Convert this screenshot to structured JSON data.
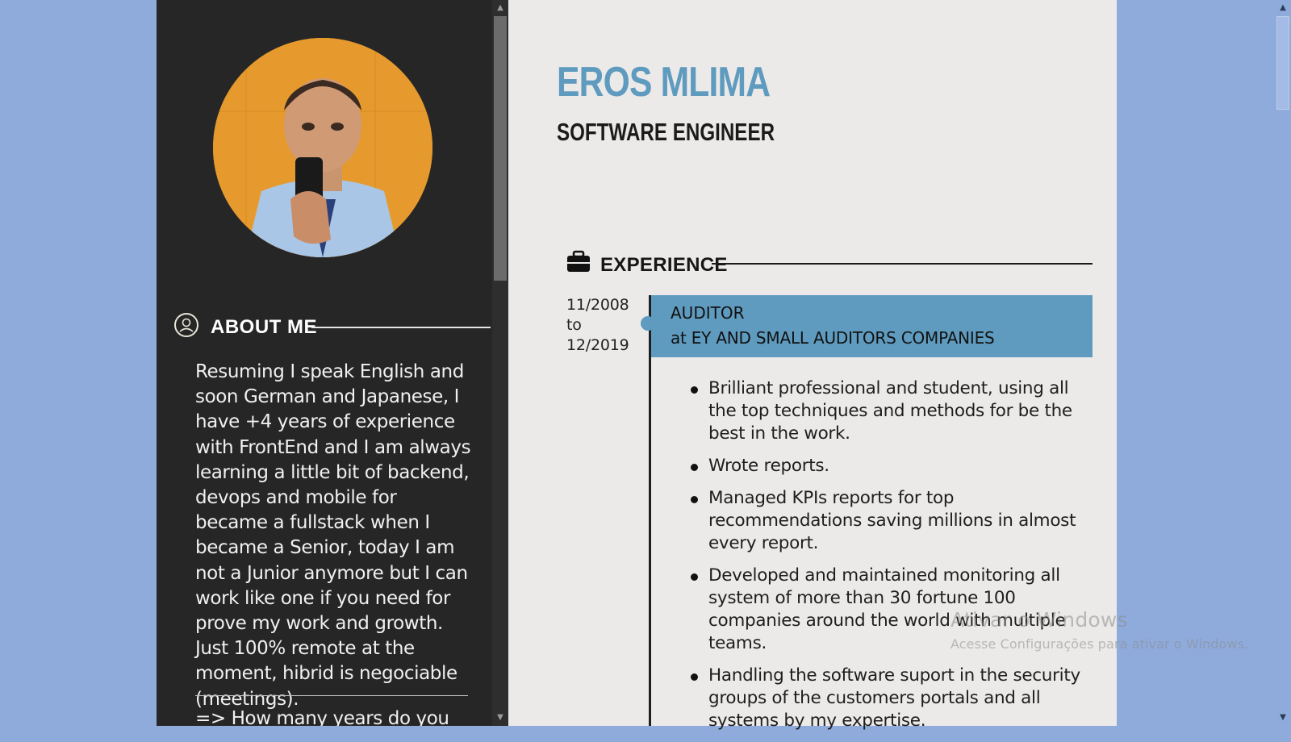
{
  "profile": {
    "name": "EROS MLIMA",
    "role": "SOFTWARE ENGINEER"
  },
  "sidebar": {
    "avatar_alt": "profile-photo",
    "about": {
      "title": "ABOUT ME",
      "text": "Resuming I speak English and soon German and Japanese, I have +4 years of experience with FrontEnd and I am always learning a little bit of backend, devops and mobile for became a fullstack when I became a Senior, today I am not a Junior anymore but I can work like one if you need for prove my work and growth. Just 100% remote at the moment, hibrid is negociable (meetings).",
      "question": "=> How many years do you"
    }
  },
  "experience": {
    "title": "EXPERIENCE",
    "jobs": [
      {
        "date_from": "11/2008",
        "date_sep": "to",
        "date_to": "12/2019",
        "position": "AUDITOR",
        "at_label": "at",
        "company": "EY AND SMALL AUDITORS COMPANIES",
        "bullets": [
          "Brilliant professional and student, using all the top techniques and methods for be the best in the work.",
          "Wrote reports.",
          "Managed KPIs reports for top recommendations saving millions in almost every report.",
          "Developed and maintained monitoring all system of more than 30 fortune 100 companies around the world with multiple teams.",
          "Handling the software suport in the security groups of the customers portals and all systems by my expertise."
        ]
      }
    ]
  },
  "watermark": {
    "line1": "Ativar o Windows",
    "line2": "Acesse Configurações para ativar o Windows."
  },
  "colors": {
    "accent": "#5f9bbf",
    "sidebar_bg": "#262626",
    "page_bg": "#eceae8",
    "desktop_bg": "#8fabdc"
  },
  "icons": {
    "about": "user-circle-icon",
    "experience": "briefcase-icon"
  }
}
